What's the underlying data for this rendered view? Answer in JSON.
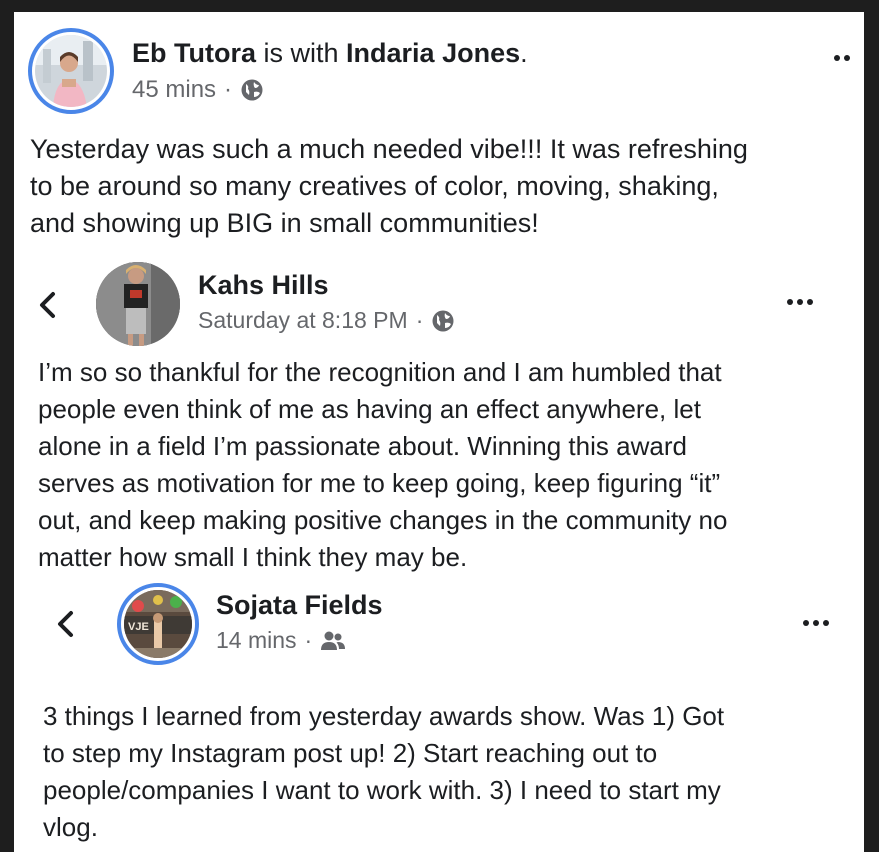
{
  "post": {
    "author": "Eb Tutora",
    "with_text": "is with",
    "tagged": "Indaria Jones",
    "period": ".",
    "time": "45 mins",
    "separator": "·",
    "privacy_icon": "globe-icon",
    "more_icon": "more-dots-icon",
    "lines": [
      "Yesterday was such a much needed vibe!!! It was refreshing",
      "to be around so many creatives of color, moving, shaking,",
      "and showing up BIG in small communities!"
    ]
  },
  "shared1": {
    "back_icon": "chevron-left-icon",
    "author": "Kahs Hills",
    "time": "Saturday at 8:18 PM",
    "separator": "·",
    "privacy_icon": "globe-icon",
    "more_icon": "more-dots-icon",
    "lines": [
      "I’m so so thankful for the recognition and I am humbled that",
      "people even think of me as having an effect anywhere, let",
      "alone in a field I’m passionate about. Winning this award",
      "serves as motivation for me to keep going, keep figuring “it”",
      "out, and keep making positive changes in the community no",
      "matter how small I think they may be."
    ]
  },
  "shared2": {
    "back_icon": "chevron-left-icon",
    "author": "Sojata Fields",
    "time": "14 mins",
    "separator": "·",
    "privacy_icon": "friends-icon",
    "more_icon": "more-dots-icon",
    "avatar_sign_text": "VJE",
    "lines": [
      "3 things I learned from yesterday awards show. Was 1) Got",
      "to step my Instagram post up! 2) Start reaching out to",
      "people/companies I want to work with. 3) I need to start my",
      "vlog."
    ]
  },
  "colors": {
    "story_ring": "#4a86e8",
    "text": "#1c1e21",
    "meta": "#65676b",
    "background": "#ffffff"
  }
}
